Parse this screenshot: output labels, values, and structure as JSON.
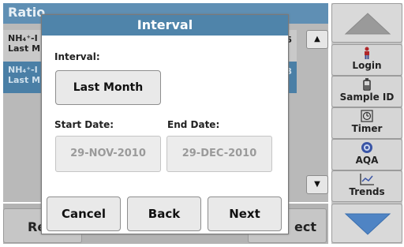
{
  "background": {
    "title": "Ratio",
    "rows": [
      {
        "line1": "NH₄⁺-I",
        "line2": "Last M",
        "suffix": "_5"
      },
      {
        "line1": "NH₄⁺-I",
        "line2": "Last M",
        "suffix": "SB"
      }
    ],
    "bottom_left_label": "Re",
    "bottom_right_label": "ect"
  },
  "sidebar": {
    "items": [
      {
        "label": "Login",
        "icon": "person-icon"
      },
      {
        "label": "Sample ID",
        "icon": "bottle-icon"
      },
      {
        "label": "Timer",
        "icon": "timer-icon"
      },
      {
        "label": "AQA",
        "icon": "aqa-icon"
      },
      {
        "label": "Trends",
        "icon": "trend-chart-icon"
      }
    ]
  },
  "dialog": {
    "title": "Interval",
    "interval_label": "Interval:",
    "interval_value": "Last Month",
    "start_label": "Start Date:",
    "end_label": "End Date:",
    "start_value": "29-NOV-2010",
    "end_value": "29-DEC-2010",
    "cancel_label": "Cancel",
    "back_label": "Back",
    "next_label": "Next"
  },
  "colors": {
    "accent": "#4f84aa",
    "accent_dark": "#4a7fa6"
  }
}
